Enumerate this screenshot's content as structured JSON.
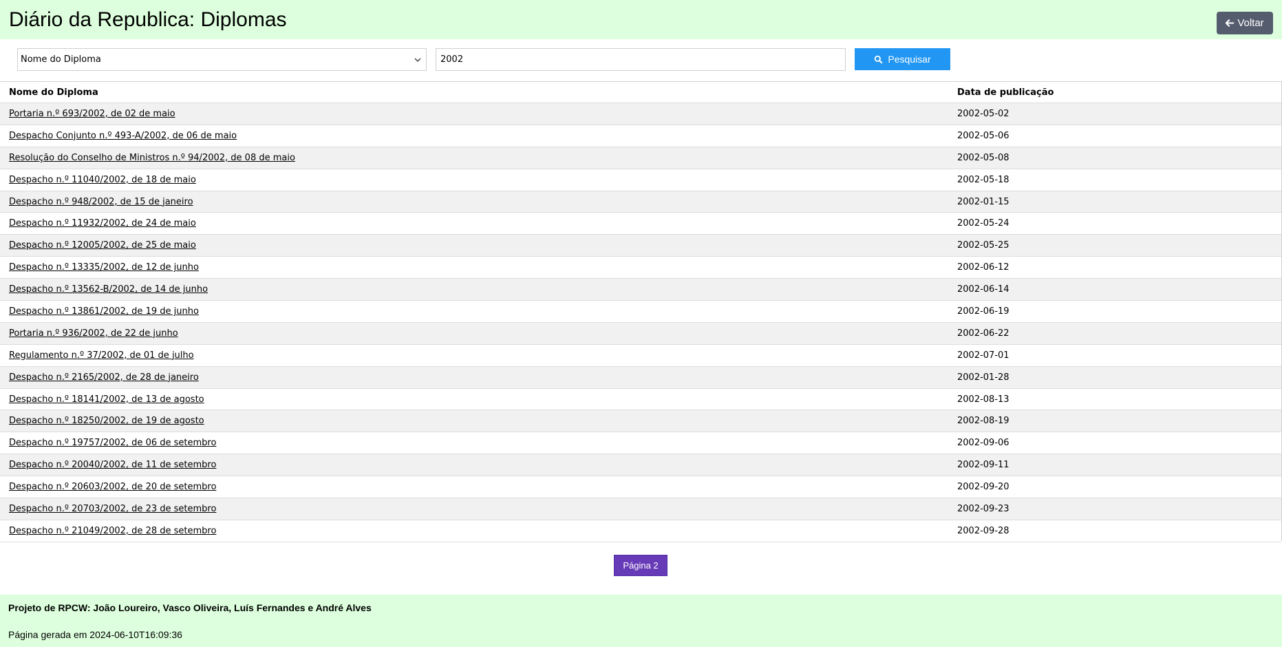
{
  "header": {
    "title": "Diário da Republica: Diplomas",
    "back_label": "Voltar"
  },
  "search": {
    "field_selected": "Nome do Diploma",
    "query": "2002",
    "button_label": "Pesquisar"
  },
  "table": {
    "columns": [
      "Nome do Diploma",
      "Data de publicação"
    ],
    "rows": [
      {
        "name": "Portaria n.º 693/2002, de 02 de maio",
        "date": "2002-05-02"
      },
      {
        "name": "Despacho Conjunto n.º 493-A/2002, de 06 de maio",
        "date": "2002-05-06"
      },
      {
        "name": "Resolução do Conselho de Ministros n.º 94/2002, de 08 de maio",
        "date": "2002-05-08"
      },
      {
        "name": "Despacho n.º 11040/2002, de 18 de maio",
        "date": "2002-05-18"
      },
      {
        "name": "Despacho n.º 948/2002, de 15 de janeiro",
        "date": "2002-01-15"
      },
      {
        "name": "Despacho n.º 11932/2002, de 24 de maio",
        "date": "2002-05-24"
      },
      {
        "name": "Despacho n.º 12005/2002, de 25 de maio",
        "date": "2002-05-25"
      },
      {
        "name": "Despacho n.º 13335/2002, de 12 de junho",
        "date": "2002-06-12"
      },
      {
        "name": "Despacho n.º 13562-B/2002, de 14 de junho",
        "date": "2002-06-14"
      },
      {
        "name": "Despacho n.º 13861/2002, de 19 de junho",
        "date": "2002-06-19"
      },
      {
        "name": "Portaria n.º 936/2002, de 22 de junho",
        "date": "2002-06-22"
      },
      {
        "name": "Regulamento n.º 37/2002, de 01 de julho",
        "date": "2002-07-01"
      },
      {
        "name": "Despacho n.º 2165/2002, de 28 de janeiro",
        "date": "2002-01-28"
      },
      {
        "name": "Despacho n.º 18141/2002, de 13 de agosto",
        "date": "2002-08-13"
      },
      {
        "name": "Despacho n.º 18250/2002, de 19 de agosto",
        "date": "2002-08-19"
      },
      {
        "name": "Despacho n.º 19757/2002, de 06 de setembro",
        "date": "2002-09-06"
      },
      {
        "name": "Despacho n.º 20040/2002, de 11 de setembro",
        "date": "2002-09-11"
      },
      {
        "name": "Despacho n.º 20603/2002, de 20 de setembro",
        "date": "2002-09-20"
      },
      {
        "name": "Despacho n.º 20703/2002, de 23 de setembro",
        "date": "2002-09-23"
      },
      {
        "name": "Despacho n.º 21049/2002, de 28 de setembro",
        "date": "2002-09-28"
      }
    ]
  },
  "pagination": {
    "next_label": "Página 2"
  },
  "footer": {
    "credits": "Projeto de RPCW: João Loureiro, Vasco Oliveira, Luís Fernandes e André Alves",
    "generated": "Página gerada em 2024-06-10T16:09:36"
  },
  "colors": {
    "header_bg": "#ddffdd",
    "search_button": "#2196f3",
    "page_button": "#673ab7",
    "back_button": "#555c6e"
  },
  "icons": {
    "back": "arrow-left-icon",
    "search": "search-icon",
    "select": "chevron-down-icon"
  }
}
